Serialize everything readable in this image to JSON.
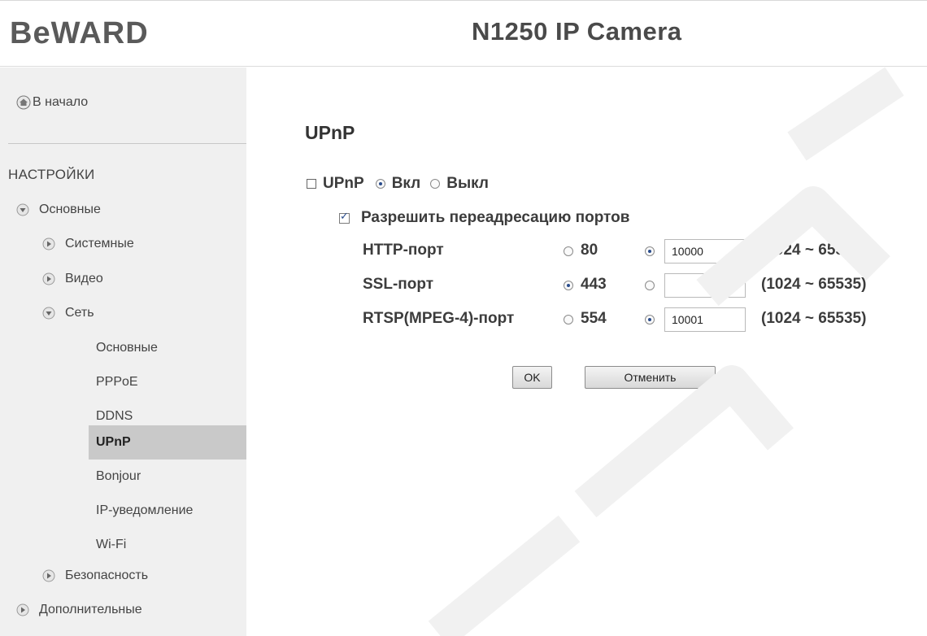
{
  "header": {
    "logo_text": "BEWARD",
    "camera_title": "N1250 IP Camera"
  },
  "sidebar": {
    "home_label": "В начало",
    "section_heading": "НАСТРОЙКИ",
    "items": [
      {
        "label": "Основные"
      },
      {
        "label": "Системные"
      },
      {
        "label": "Видео"
      },
      {
        "label": "Сеть"
      },
      {
        "label": "Основные"
      },
      {
        "label": "PPPoE"
      },
      {
        "label": "DDNS"
      },
      {
        "label": "UPnP"
      },
      {
        "label": "Bonjour"
      },
      {
        "label": "IP-уведомление"
      },
      {
        "label": "Wi-Fi"
      },
      {
        "label": "Безопасность"
      },
      {
        "label": "Дополнительные"
      }
    ],
    "active_item": "UPnP"
  },
  "main": {
    "title": "UPnP",
    "upnp_label": "UPnP",
    "on_label": "Вкл",
    "off_label": "Выкл",
    "upnp_state": "on",
    "port_forward_label": "Разрешить переадресацию портов",
    "port_forward_checked": true,
    "ports": [
      {
        "label": "HTTP-порт",
        "default": "80",
        "custom_value": "10000",
        "selected": "custom",
        "range": "(1024 ~ 65535)"
      },
      {
        "label": "SSL-порт",
        "default": "443",
        "custom_value": "",
        "selected": "default",
        "range": "(1024 ~ 65535)"
      },
      {
        "label": "RTSP(MPEG-4)-порт",
        "default": "554",
        "custom_value": "10001",
        "selected": "custom",
        "range": "(1024 ~ 65535)"
      }
    ],
    "ok_label": "OK",
    "cancel_label": "Отменить"
  },
  "colors": {
    "sidebar_bg": "#f0f0f0",
    "active_bg": "#c9c9c9",
    "radio_dot": "#2a4c8c"
  }
}
